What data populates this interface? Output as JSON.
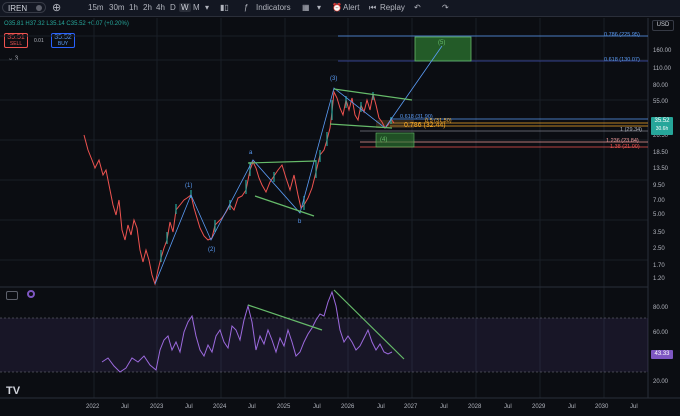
{
  "toolbar": {
    "symbol": "IREN",
    "timeframes": [
      "15m",
      "30m",
      "1h",
      "2h",
      "4h",
      "D",
      "W",
      "M"
    ],
    "active_timeframe": "W",
    "indicators_label": "Indicators",
    "alert_label": "Alert",
    "replay_label": "Replay"
  },
  "ohlc": {
    "open": "O35.81",
    "high": "H37.32",
    "low": "L35.14",
    "close": "C35.52",
    "change": "+0.07 (+0.20%)"
  },
  "trade": {
    "sell_price": "35.51",
    "sell_label": "SELL",
    "spread": "0.01",
    "buy_price": "35.52",
    "buy_label": "BUY"
  },
  "indicator_count": "3",
  "currency": "USD",
  "price_axis": [
    "160.00",
    "110.00",
    "80.00",
    "55.00",
    "26.50",
    "18.50",
    "13.50",
    "9.50",
    "7.00",
    "5.00",
    "3.50",
    "2.50",
    "1.70",
    "1.20"
  ],
  "rsi_axis": [
    "80.00",
    "60.00",
    "20.00"
  ],
  "current_price": {
    "price": "35.52",
    "sub": "30.6h"
  },
  "rsi_value": "43.33",
  "fib_levels": [
    {
      "label": "0.786 (225.95)",
      "color": "#5b9cf6"
    },
    {
      "label": "0.618 (130.07)",
      "color": "#5b9cf6"
    },
    {
      "label": "0.618 (31.90)",
      "color": "#5b9cf6"
    },
    {
      "label": "0.5 (31.50)",
      "color": "#f7a928"
    },
    {
      "label": "0.786 (32.44)",
      "color": "#f7a928"
    },
    {
      "label": "1 (29.34)",
      "color": "#b2b5be"
    },
    {
      "label": "1.236 (23.84)",
      "color": "#ef9a9a"
    },
    {
      "label": "1.38 (21.00)",
      "color": "#ef5350"
    }
  ],
  "waves": [
    "(1)",
    "(2)",
    "a",
    "b",
    "(3)",
    "(4)",
    "(5)"
  ],
  "x_axis": [
    "2022",
    "Jul",
    "2023",
    "Jul",
    "2024",
    "Jul",
    "2025",
    "Jul",
    "2026",
    "Jul",
    "2027",
    "Jul",
    "2028",
    "Jul",
    "2029",
    "Jul",
    "2030",
    "Jul"
  ],
  "colors": {
    "up": "#26a69a",
    "down": "#ef5350",
    "rsi": "#9c6ade",
    "trend": "#66bb6a",
    "wave": "#5b9cf6"
  },
  "logo": "TV"
}
